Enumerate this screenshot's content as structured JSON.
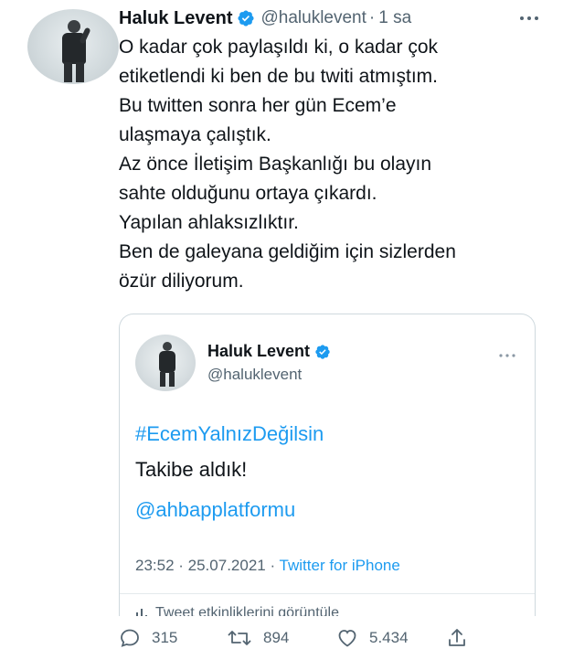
{
  "author": {
    "name": "Haluk Levent",
    "handle": "@haluklevent",
    "time": "1 sa",
    "separator": "·"
  },
  "tweet_lines": [
    "O kadar çok paylaşıldı ki, o kadar çok",
    "etiketlendi ki ben de bu twiti atmıştım.",
    "Bu twitten sonra her gün Ecem’e",
    "ulaşmaya çalıştık.",
    "Az önce İletişim Başkanlığı bu olayın",
    "sahte olduğunu ortaya çıkardı.",
    "Yapılan ahlaksızlıktır.",
    "Ben de galeyana geldiğim için sizlerden",
    "özür diliyorum."
  ],
  "quoted": {
    "name": "Haluk Levent",
    "handle": "@haluklevent",
    "hashtag": "#EcemYalnızDeğilsin",
    "text": "Takibe aldık!",
    "mention": "@ahbapplatformu",
    "datetime": "23:52 · 25.07.2021 · ",
    "source": "Twitter for iPhone",
    "activity": "Tweet etkinliklerini görüntüle"
  },
  "stats": {
    "replies": "315",
    "retweets": "894",
    "likes": "5.434"
  },
  "icons": {
    "verified": "verified-badge-icon",
    "more": "more-dots-icon",
    "reply": "reply-icon",
    "retweet": "retweet-icon",
    "like": "heart-icon",
    "share": "share-icon",
    "activity": "bar-chart-icon"
  },
  "colors": {
    "accent": "#1d9bf0",
    "text": "#0f1419",
    "secondary": "#536471",
    "border": "#cfd9de"
  }
}
